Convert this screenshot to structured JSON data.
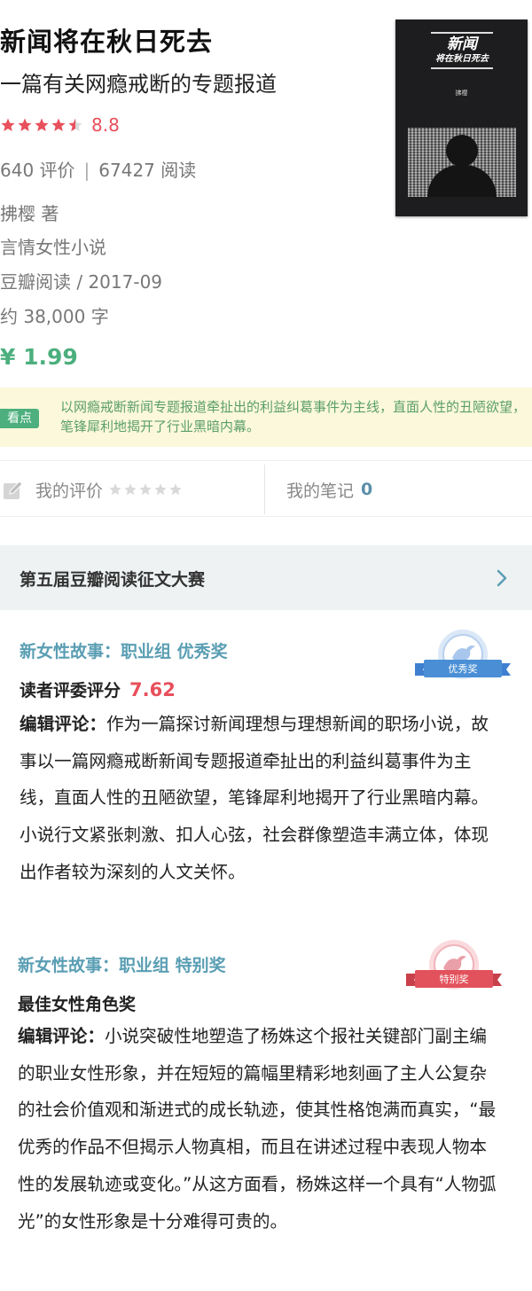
{
  "book": {
    "title": "新闻将在秋日死去",
    "subtitle": "一篇有关网瘾戒断的专题报道",
    "rating": {
      "value": "8.8",
      "stars": 4.5
    },
    "review_count": "640 评价",
    "read_count": "67427 阅读",
    "separator": "|",
    "author": "拂樱 著",
    "category": "言情女性小说",
    "publisher_date": "豆瓣阅读 / 2017-09",
    "word_count": "约 38,000 字",
    "price": "¥ 1.99",
    "cover": {
      "title_line1": "新闻",
      "title_line2": "将在秋日死去",
      "author": "拂樱"
    }
  },
  "kandian": {
    "tag": "看点",
    "text": "以网瘾戒断新闻专题报道牵扯出的利益纠葛事件为主线，直面人性的丑陋欲望，笔锋犀利地揭开了行业黑暗内幕。"
  },
  "mine": {
    "review_label": "我的评价",
    "notes_label": "我的笔记",
    "notes_count": "0"
  },
  "contest": {
    "title": "第五届豆瓣阅读征文大赛"
  },
  "awards": [
    {
      "name": "新女性故事：职业组 优秀奖",
      "badge_label": "优秀奖",
      "sub_label": "读者评委评分",
      "score": "7.62",
      "comment_lead": "编辑评论：",
      "comment": "作为一篇探讨新闻理想与理想新闻的职场小说，故事以一篇网瘾戒断新闻专题报道牵扯出的利益纠葛事件为主线，直面人性的丑陋欲望，笔锋犀利地揭开了行业黑暗内幕。小说行文紧张刺激、扣人心弦，社会群像塑造丰满立体，体现出作者较为深刻的人文关怀。"
    },
    {
      "name": "新女性故事：职业组 特别奖",
      "badge_label": "特别奖",
      "sub_label": "最佳女性角色奖",
      "comment_lead": "编辑评论：",
      "comment": "小说突破性地塑造了杨姝这个报社关键部门副主编的职业女性形象，并在短短的篇幅里精彩地刻画了主人公复杂的社会价值观和渐进式的成长轨迹，使其性格饱满而真实，“最优秀的作品不但揭示人物真相，而且在讲述过程中表现人物本性的发展轨迹或变化。”从这方面看，杨姝这样一个具有“人物弧光”的女性形象是十分难得可贵的。"
    }
  ],
  "colors": {
    "rating": "#e8505b",
    "price": "#4caf7d",
    "award_name": "#5a9eb3",
    "badge_blue": "#4a8fd6",
    "badge_red": "#e2525c",
    "kandian_bg": "#fcf8dc"
  }
}
